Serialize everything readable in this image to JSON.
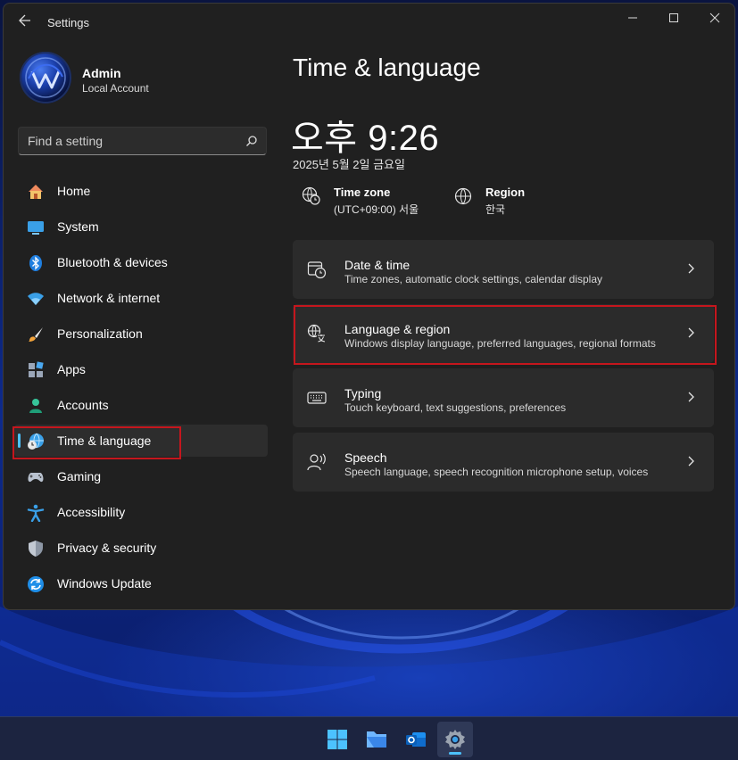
{
  "window": {
    "title": "Settings",
    "controls": [
      "minimize",
      "maximize",
      "close"
    ]
  },
  "profile": {
    "name": "Admin",
    "account_type": "Local Account"
  },
  "search": {
    "placeholder": "Find a setting"
  },
  "sidebar": {
    "items": [
      {
        "label": "Home",
        "icon": "home-icon"
      },
      {
        "label": "System",
        "icon": "system-icon"
      },
      {
        "label": "Bluetooth & devices",
        "icon": "bluetooth-icon"
      },
      {
        "label": "Network & internet",
        "icon": "wifi-icon"
      },
      {
        "label": "Personalization",
        "icon": "brush-icon"
      },
      {
        "label": "Apps",
        "icon": "apps-icon"
      },
      {
        "label": "Accounts",
        "icon": "accounts-icon"
      },
      {
        "label": "Time & language",
        "icon": "time-language-icon",
        "selected": true
      },
      {
        "label": "Gaming",
        "icon": "gamepad-icon"
      },
      {
        "label": "Accessibility",
        "icon": "accessibility-icon"
      },
      {
        "label": "Privacy & security",
        "icon": "shield-icon"
      },
      {
        "label": "Windows Update",
        "icon": "update-icon"
      }
    ]
  },
  "main": {
    "title": "Time & language",
    "clock": "오후 9:26",
    "date": "2025년 5월 2일 금요일",
    "time_zone": {
      "title": "Time zone",
      "value": "(UTC+09:00) 서울"
    },
    "region": {
      "title": "Region",
      "value": "한국"
    },
    "cards": [
      {
        "title": "Date & time",
        "description": "Time zones, automatic clock settings, calendar display",
        "icon": "clock-calendar-icon"
      },
      {
        "title": "Language & region",
        "description": "Windows display language, preferred languages, regional formats",
        "icon": "language-icon"
      },
      {
        "title": "Typing",
        "description": "Touch keyboard, text suggestions, preferences",
        "icon": "keyboard-icon"
      },
      {
        "title": "Speech",
        "description": "Speech language, speech recognition microphone setup, voices",
        "icon": "speech-icon"
      }
    ]
  },
  "taskbar": {
    "apps": [
      "start-icon",
      "file-explorer-icon",
      "outlook-icon",
      "settings-icon"
    ],
    "active_app": "settings-icon"
  },
  "colors": {
    "accent": "#4cc2ff",
    "window_bg": "#202020",
    "card_bg": "#2b2b2b",
    "highlight": "#c5161d"
  }
}
